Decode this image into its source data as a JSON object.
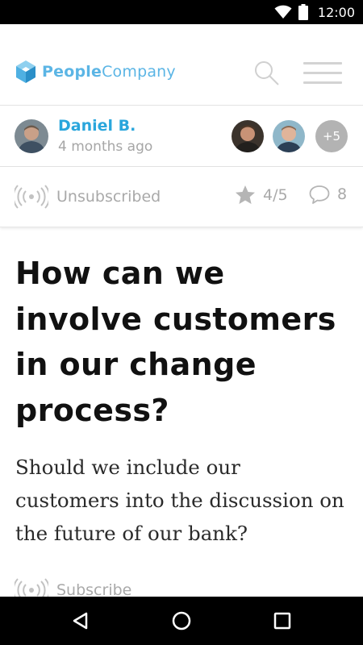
{
  "status_bar": {
    "time": "12:00",
    "icons": [
      "wifi-icon",
      "battery-icon"
    ]
  },
  "header": {
    "logo_bold": "People",
    "logo_light": "Company",
    "icons": [
      "logo-cube-icon",
      "search-icon",
      "hamburger-menu-icon"
    ]
  },
  "post": {
    "author": "Daniel B.",
    "time_ago": "4 months ago",
    "extra_participants": "+5",
    "subscription_status": "Unsubscribed",
    "rating": "4/5",
    "comment_count": "8",
    "title": "How can we involve customers in our change process?",
    "body": "Should we include our customers into the discussion on the future of our bank?",
    "subscribe_label": "Subscribe"
  },
  "nav": {
    "icons": [
      "back-icon",
      "home-icon",
      "recents-icon"
    ]
  },
  "colors": {
    "brand": "#5bb5e5",
    "author_link": "#2aa6dc",
    "muted": "#a9a9a9",
    "status_bar": "#000000"
  }
}
